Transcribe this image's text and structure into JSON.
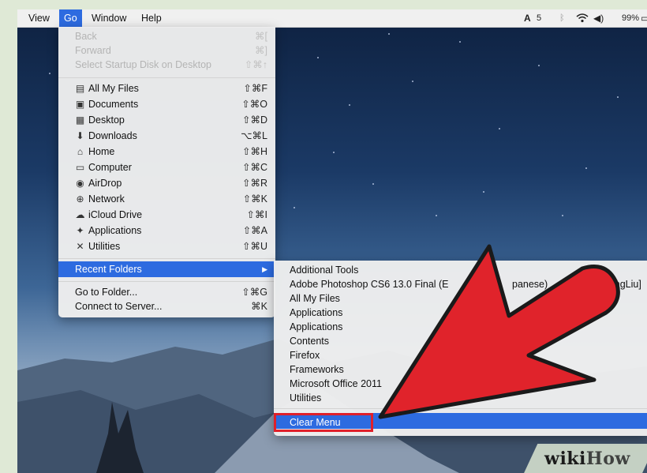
{
  "menubar": {
    "items": [
      "View",
      "Go",
      "Window",
      "Help"
    ],
    "status": {
      "adobe": "5",
      "battery": "99%"
    }
  },
  "go_menu": {
    "nav": [
      {
        "label": "Back",
        "shortcut": "⌘[",
        "enabled": false
      },
      {
        "label": "Forward",
        "shortcut": "⌘]",
        "enabled": false
      },
      {
        "label": "Select Startup Disk on Desktop",
        "shortcut": "⇧⌘↑",
        "enabled": false
      }
    ],
    "places": [
      {
        "label": "All My Files",
        "shortcut": "⇧⌘F",
        "icon": "all-my-files-icon"
      },
      {
        "label": "Documents",
        "shortcut": "⇧⌘O",
        "icon": "documents-icon"
      },
      {
        "label": "Desktop",
        "shortcut": "⇧⌘D",
        "icon": "desktop-icon"
      },
      {
        "label": "Downloads",
        "shortcut": "⌥⌘L",
        "icon": "downloads-icon"
      },
      {
        "label": "Home",
        "shortcut": "⇧⌘H",
        "icon": "home-icon"
      },
      {
        "label": "Computer",
        "shortcut": "⇧⌘C",
        "icon": "computer-icon"
      },
      {
        "label": "AirDrop",
        "shortcut": "⇧⌘R",
        "icon": "airdrop-icon"
      },
      {
        "label": "Network",
        "shortcut": "⇧⌘K",
        "icon": "network-icon"
      },
      {
        "label": "iCloud Drive",
        "shortcut": "⇧⌘I",
        "icon": "icloud-icon"
      },
      {
        "label": "Applications",
        "shortcut": "⇧⌘A",
        "icon": "applications-icon"
      },
      {
        "label": "Utilities",
        "shortcut": "⇧⌘U",
        "icon": "utilities-icon"
      }
    ],
    "recent_folders": {
      "label": "Recent Folders",
      "arrow": "▶"
    },
    "bottom": [
      {
        "label": "Go to Folder...",
        "shortcut": "⇧⌘G"
      },
      {
        "label": "Connect to Server...",
        "shortcut": "⌘K"
      }
    ]
  },
  "recent_submenu": {
    "items": [
      "Additional Tools",
      "Adobe Photoshop CS6 13.0 Final (E",
      "All My Files",
      "Applications",
      "Applications",
      "Contents",
      "Firefox",
      "Frameworks",
      "Microsoft Office 2011",
      "Utilities"
    ],
    "partial_right": [
      "panese)",
      "ChingLiu]"
    ],
    "clear": "Clear Menu"
  },
  "watermark": {
    "wiki": "wiki",
    "how": "How"
  },
  "colors": {
    "highlight": "#2d6be0",
    "annotation": "#e0202a"
  }
}
